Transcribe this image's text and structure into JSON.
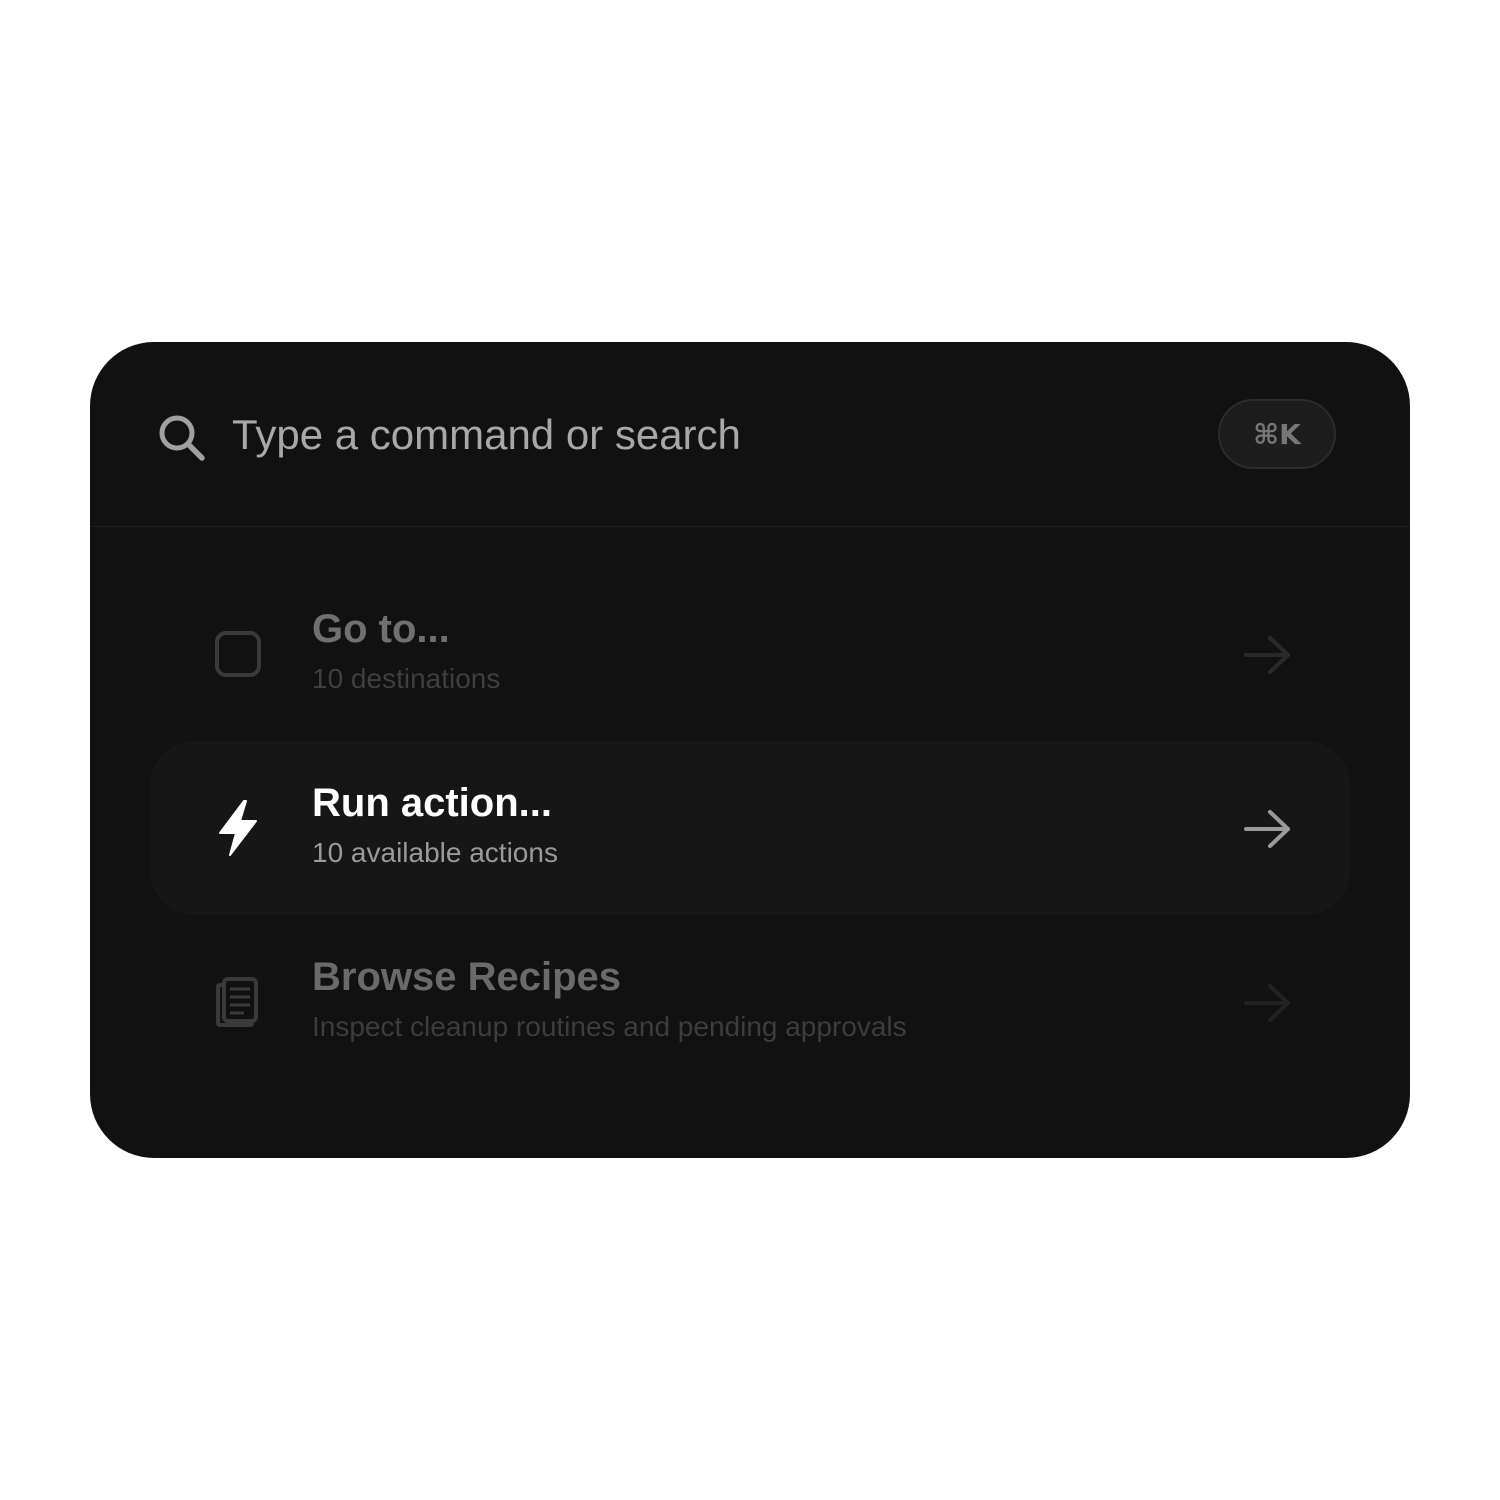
{
  "search": {
    "placeholder": "Type a command or search",
    "value": "",
    "shortcut": "⌘K",
    "icon": "search-icon"
  },
  "items": [
    {
      "title": "Go to...",
      "subtitle": "10 destinations",
      "icon": "square-icon",
      "selected": false
    },
    {
      "title": "Run action...",
      "subtitle": "10 available actions",
      "icon": "lightning-bolt-icon",
      "selected": true
    },
    {
      "title": "Browse Recipes",
      "subtitle": "Inspect cleanup routines and pending approvals",
      "icon": "document-icon",
      "selected": false
    }
  ],
  "colors": {
    "panel_background": "#111111",
    "selected_row": "#161616",
    "selected_text": "#ffffff",
    "muted_text": "#707070"
  }
}
